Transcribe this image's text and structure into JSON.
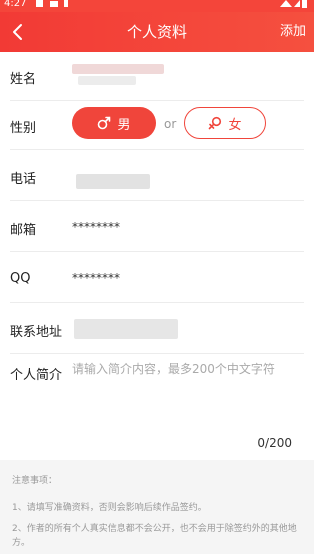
{
  "status_bar": {
    "time": "4:27"
  },
  "header": {
    "title": "个人资料",
    "action_label": "添加"
  },
  "form": {
    "name_label": "姓名",
    "gender_label": "性别",
    "gender_male": "男",
    "gender_or": "or",
    "gender_female": "女",
    "gender_selected": "男",
    "phone_label": "电话",
    "email_label": "邮箱",
    "email_value": "********",
    "qq_label": "QQ",
    "qq_value": "********",
    "address_label": "联系地址",
    "intro_label": "个人简介",
    "intro_placeholder": "请输入简介内容，最多200个中文字符",
    "intro_counter": "0/200"
  },
  "notes": {
    "title": "注意事项：",
    "items": [
      "1、请填写准确资料，否则会影响后续作品签约。",
      "2、作者的所有个人真实信息都不会公开，也不会用于除签约外的其他地方。"
    ]
  },
  "colors": {
    "accent": "#f0453b",
    "header": "#f4453a",
    "notes_bg": "#f5f5f5"
  }
}
